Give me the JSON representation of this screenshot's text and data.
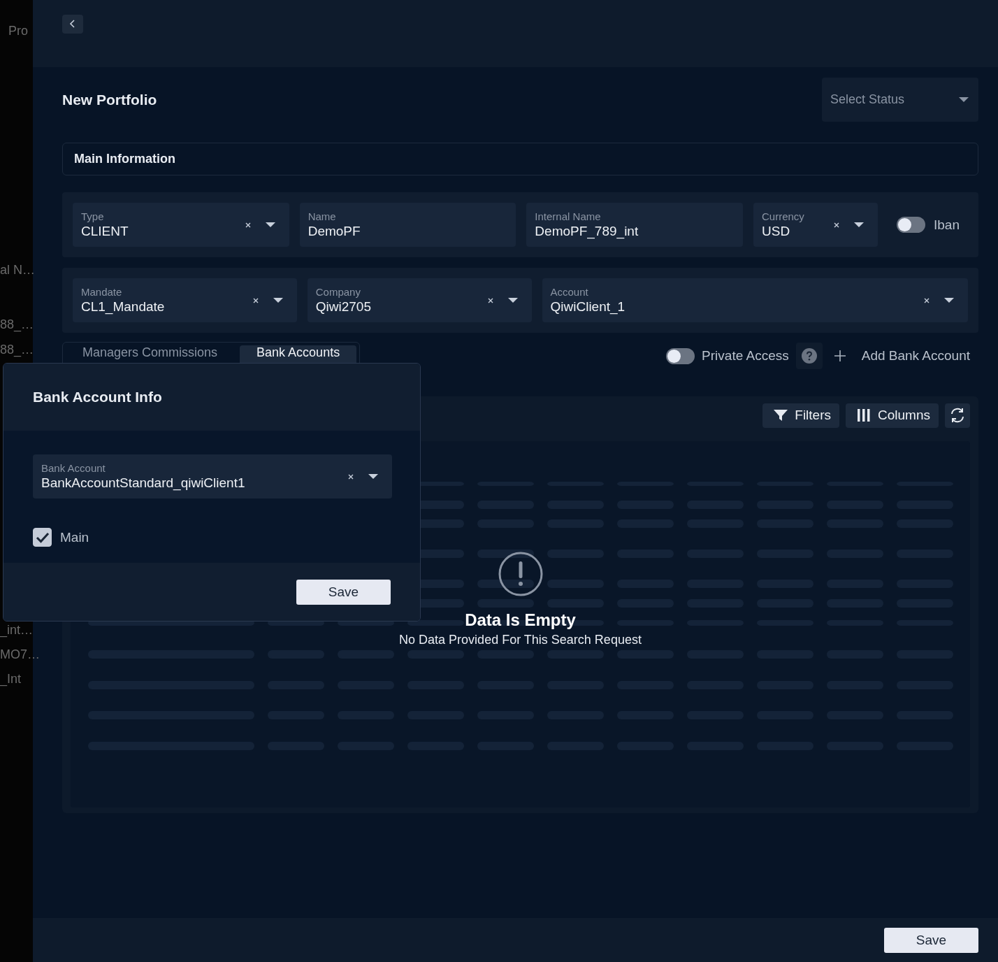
{
  "background_page": {
    "texts": [
      "Pro",
      "al N…",
      "88_…",
      "88_…",
      "_int…",
      "MO7…",
      "_Int"
    ]
  },
  "title": "New Portfolio",
  "status_select": {
    "placeholder": "Select Status"
  },
  "section_title": "Main Information",
  "field_rows": [
    [
      {
        "kind": "select",
        "label": "Type",
        "value": "CLIENT"
      },
      {
        "kind": "text",
        "label": "Name",
        "value": "DemoPF"
      },
      {
        "kind": "text",
        "label": "Internal Name",
        "value": "DemoPF_789_int"
      },
      {
        "kind": "select",
        "label": "Currency",
        "value": "USD"
      },
      {
        "kind": "toggle",
        "label": "Iban",
        "on": false
      }
    ],
    [
      {
        "kind": "select",
        "label": "Mandate",
        "value": "CL1_Mandate"
      },
      {
        "kind": "select",
        "label": "Company",
        "value": "Qiwi2705"
      },
      {
        "kind": "select",
        "label": "Account",
        "value": "QiwiClient_1"
      }
    ]
  ],
  "tabs": [
    {
      "label": "Managers Commissions",
      "selected": false
    },
    {
      "label": "Bank Accounts",
      "selected": true
    }
  ],
  "private_access": {
    "label": "Private Access",
    "on": false
  },
  "add_button": "Add Bank Account",
  "toolbar": [
    {
      "kind": "filter",
      "label": "Filters"
    },
    {
      "kind": "columns",
      "label": "Columns"
    },
    {
      "kind": "refresh"
    }
  ],
  "empty_state": {
    "title": "Data Is Empty",
    "message": "No Data Provided For This Search Request"
  },
  "modal": {
    "title": "Bank Account Info",
    "field": {
      "label": "Bank Account",
      "value": "BankAccountStandard_qiwiClient1"
    },
    "checkbox": {
      "label": "Main",
      "checked": true
    },
    "save": "Save"
  },
  "footer": {
    "save": "Save"
  }
}
